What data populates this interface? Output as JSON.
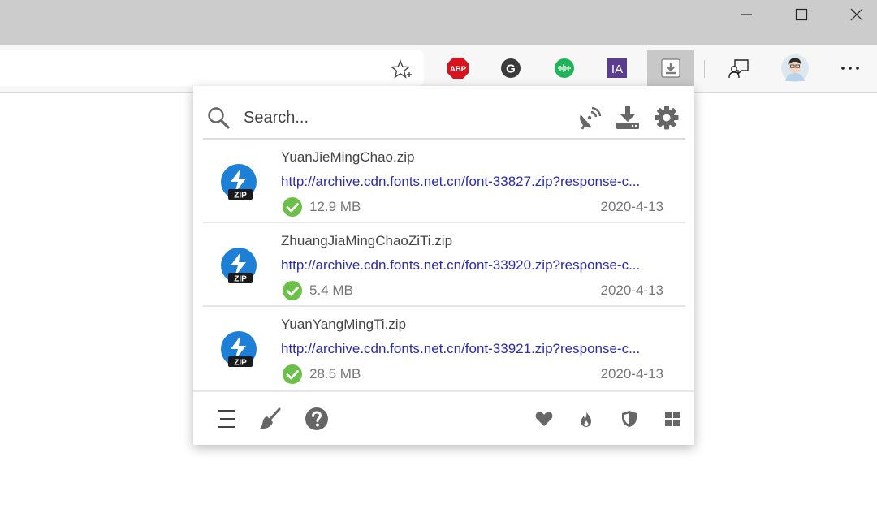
{
  "window": {
    "controls": [
      "minimize",
      "maximize",
      "close"
    ]
  },
  "toolbar": {
    "extensions": [
      {
        "name": "adblock-plus",
        "label": "ABP"
      },
      {
        "name": "grammarly",
        "label": "G"
      },
      {
        "name": "audio-extension"
      },
      {
        "name": "internet-archive",
        "label": "IA"
      },
      {
        "name": "download-manager"
      },
      {
        "name": "feedback"
      },
      {
        "name": "profile-avatar"
      },
      {
        "name": "more"
      }
    ]
  },
  "popup": {
    "search": {
      "placeholder": "Search..."
    },
    "downloads": [
      {
        "filename": "YuanJieMingChao.zip",
        "url": "http://archive.cdn.fonts.net.cn/font-33827.zip?response-c...",
        "size": "12.9 MB",
        "date": "2020-4-13",
        "status": "complete"
      },
      {
        "filename": "ZhuangJiaMingChaoZiTi.zip",
        "url": "http://archive.cdn.fonts.net.cn/font-33920.zip?response-c...",
        "size": "5.4 MB",
        "date": "2020-4-13",
        "status": "complete"
      },
      {
        "filename": "YuanYangMingTi.zip",
        "url": "http://archive.cdn.fonts.net.cn/font-33921.zip?response-c...",
        "size": "28.5 MB",
        "date": "2020-4-13",
        "status": "complete"
      }
    ],
    "zip_badge": "ZIP",
    "colors": {
      "link": "#2b2bb0",
      "check": "#6cc04a",
      "zip_blue": "#1e7fd6",
      "icon_gray": "#666666"
    }
  }
}
